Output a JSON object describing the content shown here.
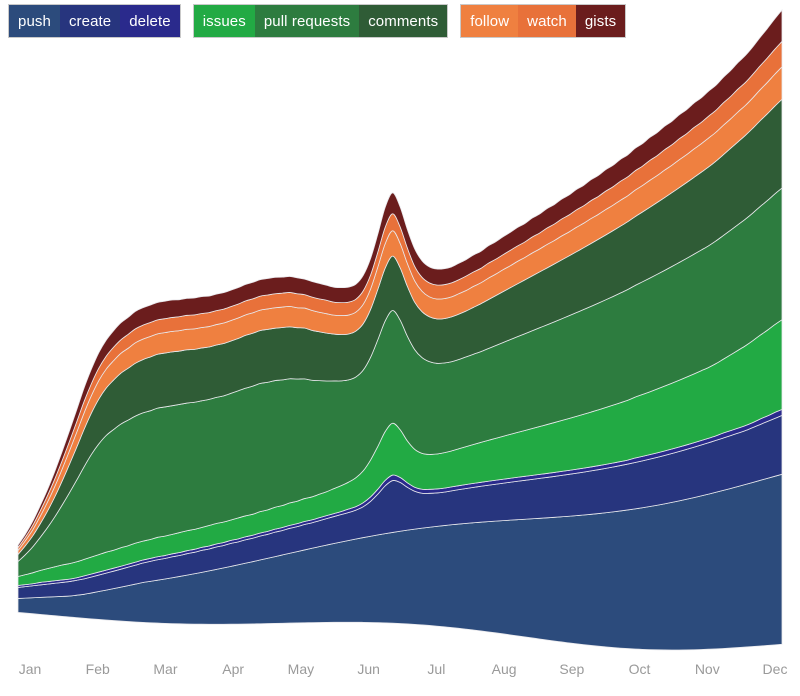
{
  "legend": {
    "groups": [
      {
        "name": "repository-activity",
        "items": [
          {
            "label": "push",
            "color": "#2c4b7c"
          },
          {
            "label": "create",
            "color": "#27357e"
          },
          {
            "label": "delete",
            "color": "#2a2a8c"
          }
        ]
      },
      {
        "name": "collaboration-activity",
        "items": [
          {
            "label": "issues",
            "color": "#22aa44"
          },
          {
            "label": "pull requests",
            "color": "#2d7c3f"
          },
          {
            "label": "comments",
            "color": "#2f5c36"
          }
        ]
      },
      {
        "name": "social-activity",
        "items": [
          {
            "label": "follow",
            "color": "#ef8040"
          },
          {
            "label": "watch",
            "color": "#e8713a"
          },
          {
            "label": "gists",
            "color": "#6b1d1d"
          }
        ]
      }
    ]
  },
  "x_axis": {
    "labels": [
      "Jan",
      "Feb",
      "Mar",
      "Apr",
      "May",
      "Jun",
      "Jul",
      "Aug",
      "Sep",
      "Oct",
      "Nov",
      "Dec"
    ]
  },
  "chart_data": {
    "type": "area",
    "stacked": true,
    "offset": "wiggle",
    "title": "",
    "xlabel": "",
    "ylabel": "",
    "grid": false,
    "legend_position": "top-left",
    "categories": [
      "Jan",
      "Feb",
      "Mar",
      "Apr",
      "May",
      "Jun",
      "Jul",
      "Aug",
      "Sep",
      "Oct",
      "Nov",
      "Dec"
    ],
    "x": [
      0,
      1,
      2,
      3,
      4,
      5,
      6,
      7,
      8,
      9,
      10,
      11,
      12,
      13,
      14,
      15,
      16,
      17,
      18,
      19,
      20,
      21,
      22,
      23,
      24,
      25,
      26,
      27,
      28,
      29,
      30,
      31,
      32,
      33,
      34,
      35,
      36,
      37,
      38,
      39,
      40,
      41,
      42,
      43,
      44,
      45,
      46,
      47,
      48,
      49,
      50,
      51,
      52,
      53,
      54,
      55,
      56,
      57,
      58,
      59,
      60,
      61,
      62,
      63,
      64,
      65,
      66,
      67,
      68,
      69,
      70,
      71,
      72,
      73,
      74,
      75,
      76,
      77,
      78,
      79,
      80,
      81,
      82,
      83,
      84,
      85,
      86,
      87,
      88,
      89,
      90,
      91,
      92,
      93,
      94,
      95,
      96,
      97,
      98,
      99,
      100,
      101,
      102,
      103,
      104
    ],
    "series": [
      {
        "name": "push",
        "color": "#2c4b7c",
        "values": [
          28,
          30,
          32,
          34,
          36,
          38,
          40,
          42,
          45,
          48,
          52,
          56,
          60,
          64,
          68,
          72,
          76,
          80,
          83,
          86,
          89,
          92,
          95,
          98,
          101,
          104,
          107,
          110,
          113,
          116,
          119,
          122,
          125,
          128,
          131,
          134,
          137,
          140,
          143,
          146,
          149,
          152,
          155,
          158,
          161,
          164,
          167,
          170,
          173,
          176,
          179,
          182,
          185,
          188,
          191,
          194,
          197,
          200,
          203,
          206,
          209,
          212,
          215,
          218,
          221,
          224,
          227,
          230,
          233,
          236,
          239,
          242,
          245,
          248,
          251,
          254,
          257,
          260,
          263,
          266,
          269,
          272,
          275,
          278,
          281,
          284,
          287,
          290,
          293,
          296,
          299,
          302,
          305,
          308,
          311,
          314,
          317,
          320,
          323,
          326,
          329,
          332,
          335,
          338,
          341
        ]
      },
      {
        "name": "create",
        "color": "#27357e",
        "values": [
          22,
          23,
          24,
          25,
          26,
          27,
          28,
          29,
          30,
          31,
          32,
          33,
          34,
          35,
          36,
          37,
          38,
          39,
          40,
          41,
          41,
          42,
          42,
          43,
          43,
          44,
          44,
          45,
          45,
          46,
          46,
          47,
          47,
          48,
          48,
          49,
          49,
          50,
          50,
          51,
          51,
          52,
          53,
          54,
          55,
          56,
          58,
          62,
          70,
          82,
          96,
          104,
          98,
          86,
          76,
          70,
          68,
          67,
          67,
          68,
          69,
          70,
          71,
          72,
          73,
          74,
          75,
          76,
          77,
          78,
          79,
          80,
          81,
          82,
          83,
          84,
          85,
          86,
          87,
          88,
          89,
          90,
          91,
          92,
          93,
          94,
          95,
          96,
          97,
          98,
          99,
          100,
          101,
          102,
          103,
          104,
          105,
          106,
          107,
          108,
          110,
          112,
          114,
          116,
          118
        ]
      },
      {
        "name": "delete",
        "color": "#2a2a8c",
        "values": [
          4,
          4,
          4,
          5,
          5,
          5,
          5,
          5,
          5,
          6,
          6,
          6,
          6,
          6,
          6,
          6,
          6,
          6,
          6,
          6,
          6,
          6,
          6,
          6,
          6,
          6,
          6,
          6,
          6,
          6,
          6,
          6,
          6,
          6,
          6,
          6,
          6,
          6,
          6,
          6,
          6,
          6,
          6,
          6,
          6,
          7,
          7,
          8,
          9,
          10,
          11,
          11,
          10,
          9,
          8,
          8,
          8,
          8,
          8,
          8,
          8,
          8,
          8,
          8,
          8,
          8,
          8,
          8,
          8,
          8,
          8,
          8,
          8,
          8,
          8,
          8,
          8,
          8,
          8,
          8,
          8,
          8,
          8,
          8,
          9,
          9,
          9,
          9,
          9,
          9,
          9,
          9,
          9,
          9,
          9,
          9,
          10,
          10,
          10,
          10,
          10,
          11,
          11,
          12,
          12
        ]
      },
      {
        "name": "issues",
        "color": "#22aa44",
        "values": [
          18,
          20,
          22,
          24,
          26,
          28,
          30,
          31,
          32,
          33,
          34,
          35,
          36,
          36,
          37,
          37,
          38,
          38,
          38,
          39,
          39,
          39,
          40,
          40,
          40,
          40,
          41,
          41,
          41,
          41,
          42,
          42,
          42,
          43,
          43,
          44,
          44,
          45,
          45,
          46,
          46,
          47,
          48,
          50,
          52,
          54,
          58,
          64,
          74,
          86,
          98,
          104,
          96,
          84,
          76,
          72,
          70,
          70,
          71,
          72,
          74,
          76,
          78,
          80,
          82,
          84,
          86,
          88,
          90,
          92,
          94,
          96,
          98,
          100,
          102,
          104,
          106,
          108,
          110,
          112,
          114,
          116,
          118,
          120,
          122,
          124,
          126,
          128,
          130,
          132,
          134,
          136,
          138,
          140,
          142,
          145,
          148,
          152,
          156,
          160,
          164,
          168,
          172,
          176,
          180
        ]
      },
      {
        "name": "pull requests",
        "color": "#2d7c3f",
        "values": [
          30,
          40,
          52,
          66,
          82,
          100,
          120,
          142,
          164,
          186,
          206,
          222,
          234,
          242,
          248,
          252,
          255,
          257,
          258,
          259,
          259,
          258,
          257,
          256,
          255,
          254,
          253,
          253,
          253,
          254,
          255,
          256,
          257,
          257,
          256,
          254,
          252,
          249,
          245,
          240,
          234,
          228,
          222,
          216,
          210,
          205,
          202,
          202,
          206,
          214,
          222,
          226,
          220,
          210,
          200,
          192,
          186,
          182,
          180,
          179,
          179,
          180,
          181,
          182,
          184,
          186,
          188,
          190,
          192,
          194,
          196,
          198,
          200,
          202,
          204,
          206,
          208,
          210,
          212,
          214,
          216,
          218,
          220,
          222,
          224,
          226,
          228,
          230,
          232,
          234,
          236,
          238,
          240,
          242,
          244,
          246,
          248,
          250,
          252,
          254,
          256,
          258,
          260,
          262,
          264
        ]
      },
      {
        "name": "comments",
        "color": "#2f5c36",
        "values": [
          14,
          18,
          22,
          27,
          33,
          40,
          48,
          57,
          66,
          75,
          83,
          90,
          95,
          99,
          102,
          104,
          106,
          107,
          108,
          108,
          108,
          108,
          107,
          107,
          106,
          106,
          105,
          105,
          105,
          105,
          105,
          106,
          106,
          106,
          106,
          105,
          105,
          104,
          103,
          102,
          100,
          98,
          96,
          94,
          93,
          92,
          92,
          93,
          96,
          101,
          106,
          109,
          105,
          100,
          95,
          92,
          90,
          89,
          89,
          90,
          91,
          92,
          94,
          96,
          98,
          100,
          102,
          104,
          106,
          108,
          110,
          112,
          114,
          116,
          118,
          120,
          122,
          124,
          126,
          128,
          130,
          132,
          134,
          136,
          138,
          140,
          142,
          144,
          146,
          148,
          150,
          152,
          154,
          156,
          158,
          160,
          162,
          164,
          166,
          168,
          170,
          172,
          174,
          176,
          178
        ]
      },
      {
        "name": "follow",
        "color": "#ef8040",
        "values": [
          8,
          10,
          12,
          15,
          18,
          21,
          24,
          27,
          30,
          33,
          35,
          37,
          38,
          39,
          40,
          40,
          41,
          41,
          41,
          41,
          41,
          41,
          41,
          41,
          41,
          41,
          41,
          41,
          41,
          41,
          41,
          41,
          41,
          41,
          41,
          41,
          41,
          41,
          40,
          40,
          40,
          39,
          39,
          38,
          38,
          38,
          38,
          39,
          41,
          45,
          49,
          51,
          49,
          46,
          43,
          41,
          40,
          40,
          40,
          40,
          41,
          41,
          42,
          42,
          43,
          43,
          44,
          44,
          45,
          45,
          46,
          46,
          47,
          47,
          48,
          48,
          49,
          49,
          50,
          50,
          51,
          51,
          52,
          52,
          53,
          53,
          54,
          54,
          55,
          55,
          56,
          56,
          57,
          57,
          58,
          58,
          59,
          59,
          60,
          60,
          61,
          62,
          63,
          64,
          65
        ]
      },
      {
        "name": "watch",
        "color": "#e8713a",
        "values": [
          6,
          7,
          9,
          11,
          13,
          15,
          17,
          19,
          21,
          23,
          24,
          25,
          26,
          27,
          27,
          28,
          28,
          28,
          28,
          28,
          28,
          28,
          28,
          28,
          28,
          28,
          28,
          28,
          28,
          28,
          28,
          28,
          28,
          28,
          28,
          28,
          28,
          28,
          28,
          27,
          27,
          27,
          27,
          26,
          26,
          26,
          26,
          27,
          28,
          30,
          33,
          34,
          33,
          31,
          29,
          28,
          28,
          28,
          28,
          28,
          28,
          29,
          29,
          29,
          30,
          30,
          30,
          31,
          31,
          31,
          32,
          32,
          33,
          33,
          34,
          34,
          35,
          35,
          36,
          36,
          37,
          37,
          38,
          38,
          39,
          39,
          40,
          40,
          41,
          41,
          42,
          42,
          43,
          43,
          44,
          44,
          45,
          45,
          46,
          46,
          47,
          48,
          49,
          50,
          51
        ]
      },
      {
        "name": "gists",
        "color": "#6b1d1d",
        "values": [
          5,
          6,
          8,
          10,
          12,
          15,
          18,
          21,
          24,
          27,
          29,
          31,
          32,
          33,
          34,
          34,
          35,
          35,
          35,
          35,
          35,
          35,
          34,
          34,
          34,
          34,
          33,
          33,
          33,
          33,
          33,
          33,
          33,
          33,
          33,
          33,
          32,
          32,
          32,
          31,
          31,
          31,
          30,
          30,
          30,
          30,
          30,
          31,
          33,
          36,
          40,
          42,
          40,
          37,
          35,
          33,
          32,
          32,
          32,
          32,
          33,
          33,
          34,
          34,
          35,
          35,
          36,
          36,
          37,
          37,
          38,
          38,
          39,
          39,
          40,
          40,
          41,
          41,
          42,
          42,
          43,
          43,
          44,
          44,
          45,
          45,
          46,
          46,
          47,
          47,
          48,
          48,
          49,
          49,
          50,
          50,
          51,
          52,
          53,
          54,
          55,
          57,
          59,
          61,
          63
        ]
      }
    ]
  }
}
